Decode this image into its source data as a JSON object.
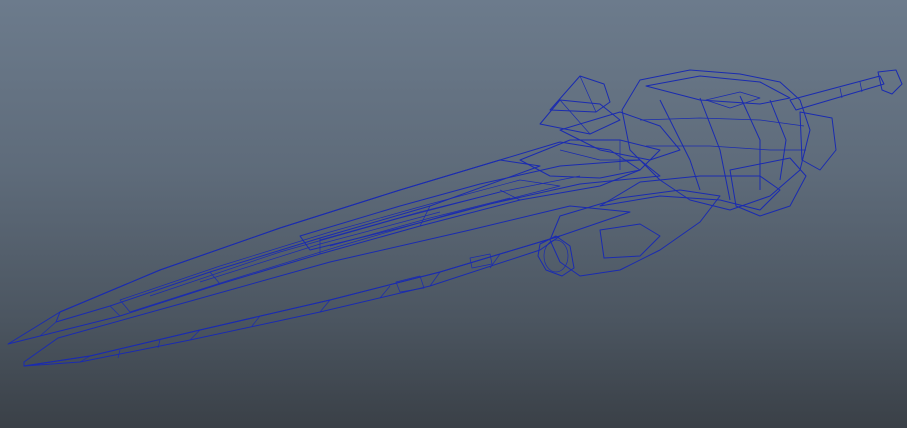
{
  "viewport": {
    "background_top": "#6c7b8c",
    "background_bottom": "#3a4047",
    "wire_color": "#1a2bb0",
    "shade_dark": "#3d3f44",
    "shade_mid": "#55575c",
    "shade_light": "#6b6d72"
  },
  "model": {
    "icon": "sword-wireframe-model",
    "display_mode": "wireframe-on-shaded"
  }
}
